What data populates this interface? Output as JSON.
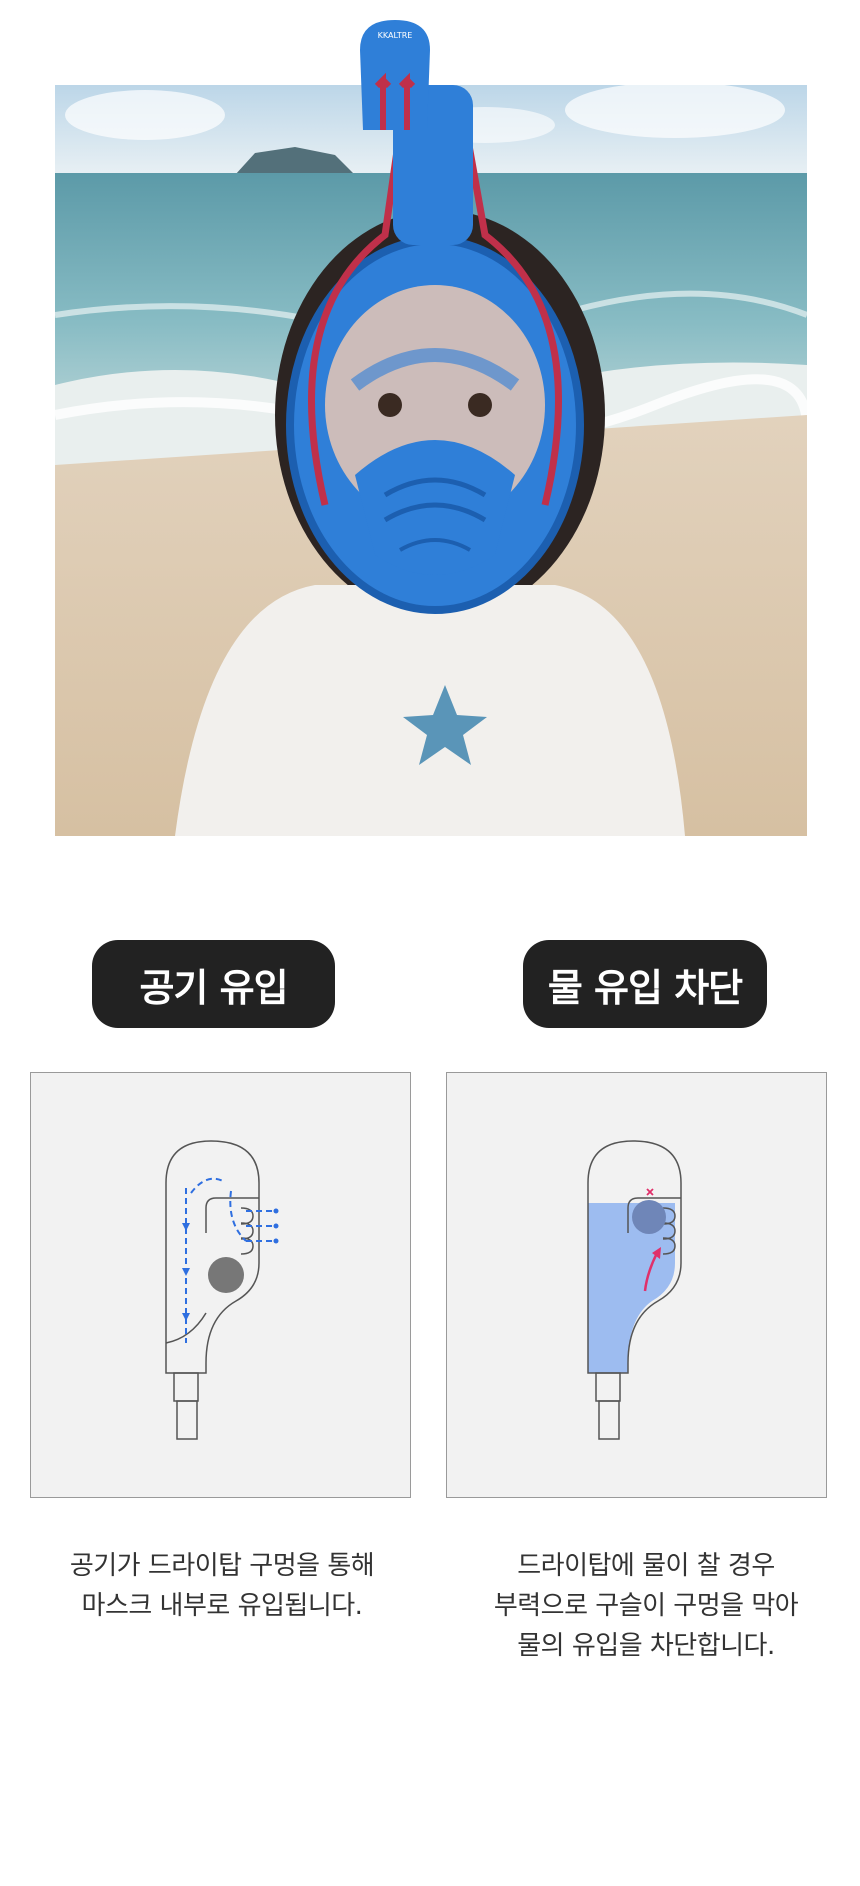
{
  "hero": {
    "image_alt": "Child wearing a blue full-face snorkel mask on a beach",
    "mask_brand": "KKALTRE"
  },
  "features": [
    {
      "badge": "공기 유입",
      "caption_lines": [
        "공기가 드라이탑 구멍을 통해",
        "마스크 내부로 유입됩니다."
      ]
    },
    {
      "badge": "물 유입 차단",
      "caption_lines": [
        "드라이탑에 물이 찰 경우",
        "부력으로 구슬이 구멍을 막아",
        "물의 유입을 차단합니다."
      ]
    }
  ],
  "colors": {
    "badge_bg": "#222222",
    "panel_bg": "#f2f2f2",
    "arrow_blue": "#2f6fe0",
    "water_fill": "#9dbcf0",
    "arrow_red": "#e0306a",
    "mask_blue": "#2f7fd8",
    "air_red": "#c0304a"
  }
}
